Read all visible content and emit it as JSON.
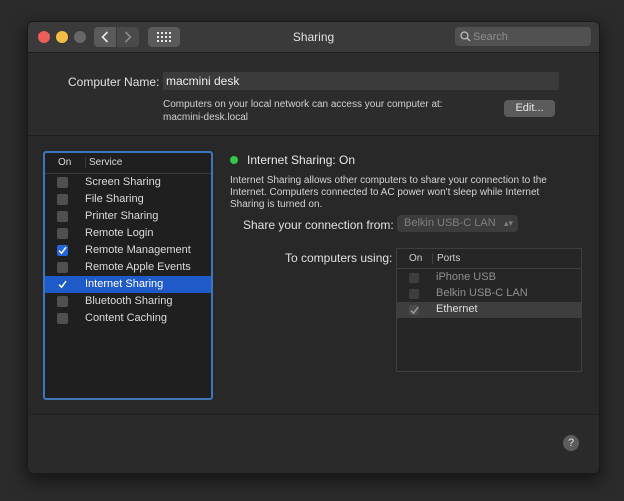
{
  "window": {
    "title": "Sharing"
  },
  "search": {
    "placeholder": "Search"
  },
  "computer": {
    "label": "Computer Name:",
    "value": "macmini desk",
    "description_line1": "Computers on your local network can access your computer at:",
    "description_line2": "macmini-desk.local",
    "edit_label": "Edit..."
  },
  "services": {
    "header_on": "On",
    "header_service": "Service",
    "items": [
      {
        "label": "Screen Sharing",
        "checked": false,
        "selected": false
      },
      {
        "label": "File Sharing",
        "checked": false,
        "selected": false
      },
      {
        "label": "Printer Sharing",
        "checked": false,
        "selected": false
      },
      {
        "label": "Remote Login",
        "checked": false,
        "selected": false
      },
      {
        "label": "Remote Management",
        "checked": true,
        "selected": false
      },
      {
        "label": "Remote Apple Events",
        "checked": false,
        "selected": false
      },
      {
        "label": "Internet Sharing",
        "checked": true,
        "selected": true
      },
      {
        "label": "Bluetooth Sharing",
        "checked": false,
        "selected": false
      },
      {
        "label": "Content Caching",
        "checked": false,
        "selected": false
      }
    ]
  },
  "detail": {
    "status_title": "Internet Sharing: On",
    "status_color": "#33c748",
    "description": "Internet Sharing allows other computers to share your connection to the Internet. Computers connected to AC power won't sleep while Internet Sharing is turned on.",
    "share_from_label": "Share your connection from:",
    "share_from_value": "Belkin USB-C LAN",
    "to_label": "To computers using:",
    "ports_header_on": "On",
    "ports_header_ports": "Ports",
    "ports": [
      {
        "label": "iPhone USB",
        "checked": false,
        "selected": false
      },
      {
        "label": "Belkin USB-C LAN",
        "checked": false,
        "selected": false
      },
      {
        "label": "Ethernet",
        "checked": true,
        "selected": true
      }
    ]
  },
  "help": {
    "label": "?"
  },
  "colors": {
    "accent": "#1f5ac9",
    "focus_ring": "#3f74b8"
  }
}
